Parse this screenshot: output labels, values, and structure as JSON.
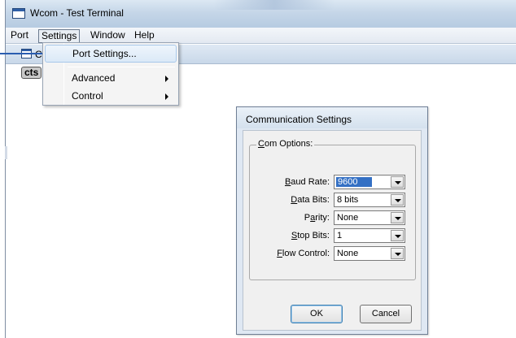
{
  "window": {
    "title": "Wcom - Test Terminal"
  },
  "menubar": {
    "items": [
      "Port",
      "Settings",
      "Window",
      "Help"
    ]
  },
  "child_window": {
    "title_fragment": "C",
    "status_badge": "cts"
  },
  "settings_menu": {
    "items": [
      {
        "label": "Port Settings...",
        "has_submenu": false,
        "highlighted": true
      },
      {
        "label": "Advanced",
        "has_submenu": true
      },
      {
        "label": "Control",
        "has_submenu": true
      }
    ]
  },
  "dialog": {
    "title": "Communication Settings",
    "group_title_pre": "",
    "group_title_u": "C",
    "group_title_post": "om Options:",
    "fields": {
      "baud_rate": {
        "label_pre": "",
        "label_u": "B",
        "label_post": "aud Rate:",
        "value": "9600"
      },
      "data_bits": {
        "label_pre": "",
        "label_u": "D",
        "label_post": "ata Bits:",
        "value": "8 bits"
      },
      "parity": {
        "label_pre": "P",
        "label_u": "a",
        "label_post": "rity:",
        "value": "None"
      },
      "stop_bits": {
        "label_pre": "",
        "label_u": "S",
        "label_post": "top Bits:",
        "value": "1"
      },
      "flow_control": {
        "label_pre": "",
        "label_u": "F",
        "label_post": "low Control:",
        "value": "None"
      }
    },
    "ok_label": "OK",
    "cancel_label": "Cancel"
  },
  "colors": {
    "selection": "#3470c4",
    "titlebar": "#c5d6e8",
    "accent": "#2a5db0"
  }
}
